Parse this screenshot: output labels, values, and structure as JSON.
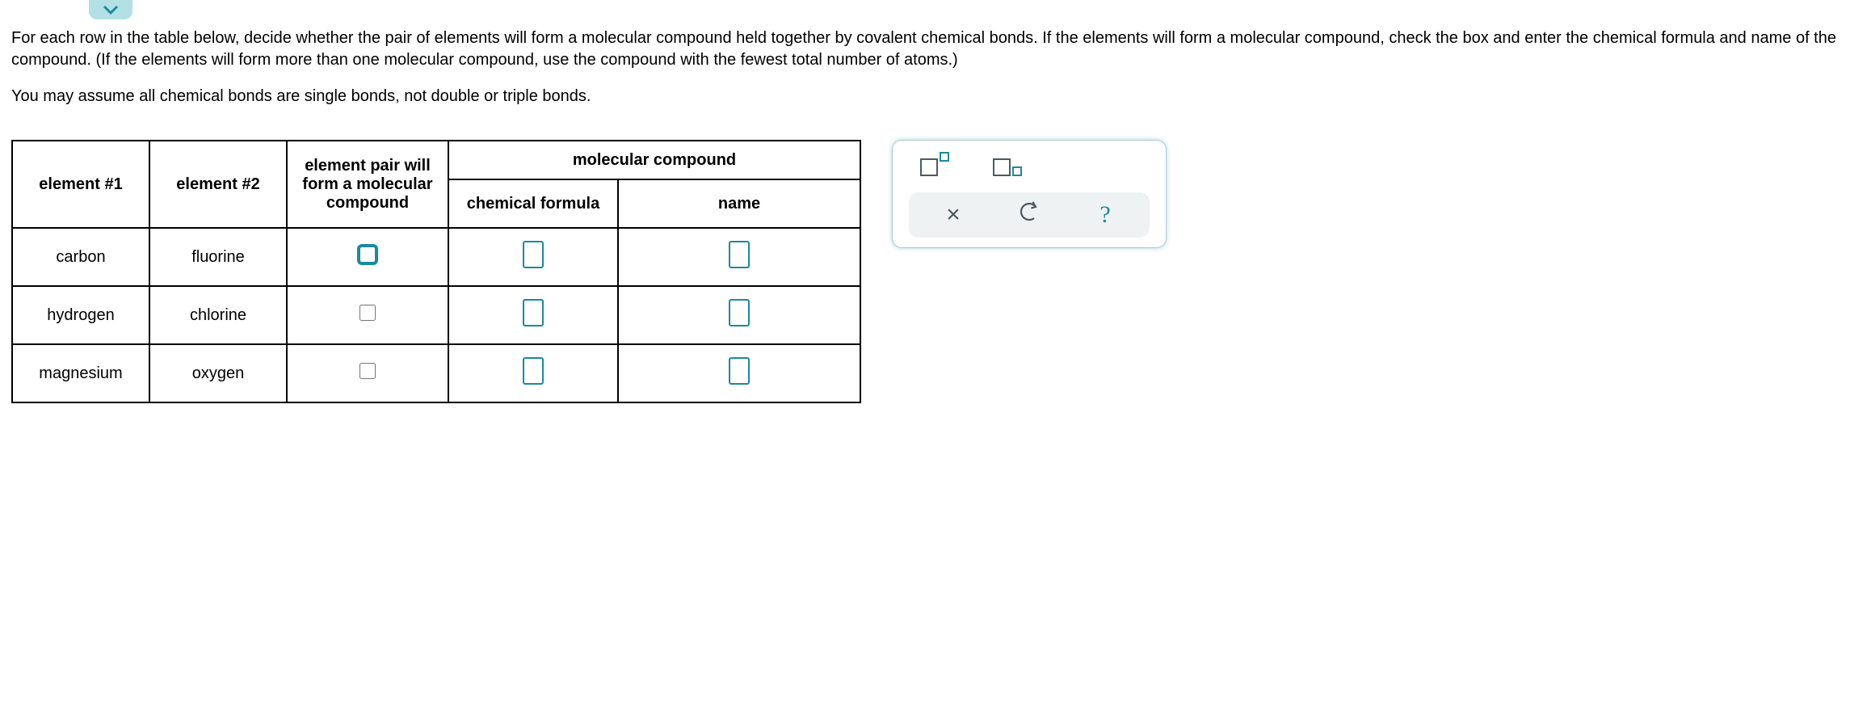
{
  "chevron": "chevron-down-icon",
  "instructions": {
    "p1": "For each row in the table below, decide whether the pair of elements will form a molecular compound held together by covalent chemical bonds. If the elements will form a molecular compound, check the box and enter the chemical formula and name of the compound. (If the elements will form more than one molecular compound, use the compound with the fewest total number of atoms.)",
    "p2": "You may assume all chemical bonds are single bonds, not double or triple bonds."
  },
  "table": {
    "headers": {
      "element1": "element #1",
      "element2": "element #2",
      "pair": "element pair will form a molecular compound",
      "molecular": "molecular compound",
      "formula": "chemical formula",
      "name": "name"
    },
    "rows": [
      {
        "e1": "carbon",
        "e2": "fluorine",
        "highlighted": true
      },
      {
        "e1": "hydrogen",
        "e2": "chlorine",
        "highlighted": false
      },
      {
        "e1": "magnesium",
        "e2": "oxygen",
        "highlighted": false
      }
    ]
  },
  "toolbox": {
    "superscript": "superscript-icon",
    "subscript": "subscript-icon",
    "close": "×",
    "undo": "undo-icon",
    "help": "?"
  }
}
